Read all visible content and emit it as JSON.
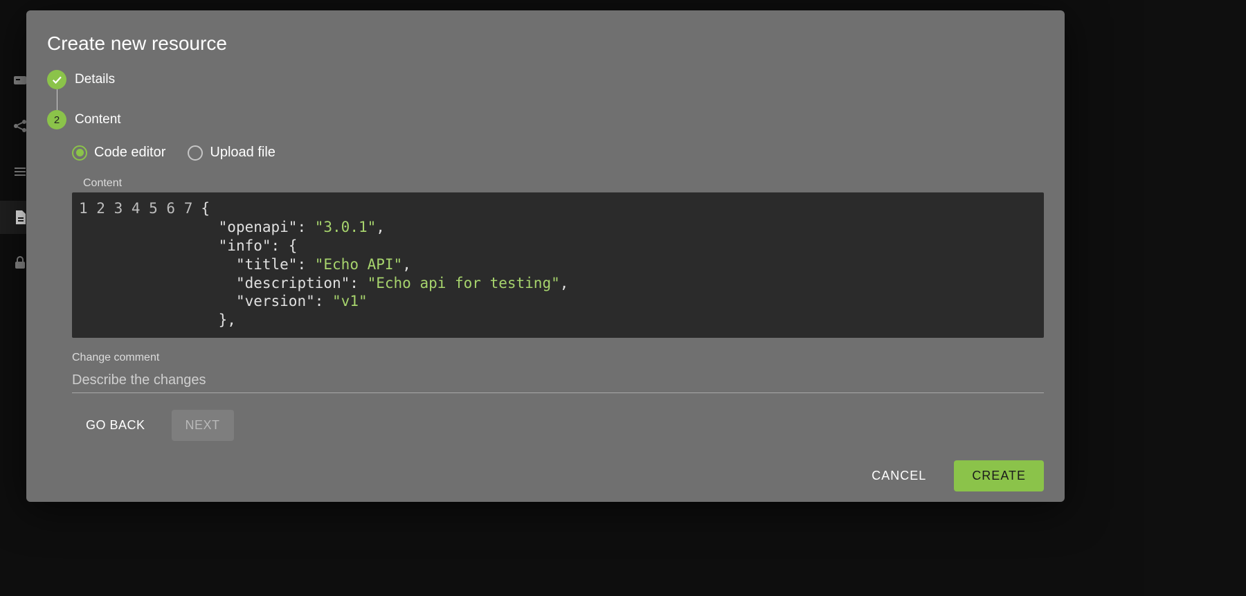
{
  "modal": {
    "title": "Create new resource",
    "steps": [
      {
        "id": "details",
        "label": "Details",
        "state": "done"
      },
      {
        "id": "content",
        "label": "Content",
        "state": "current",
        "number": "2"
      }
    ],
    "content": {
      "radios": [
        {
          "id": "code-editor",
          "label": "Code editor",
          "selected": true
        },
        {
          "id": "upload-file",
          "label": "Upload file",
          "selected": false
        }
      ],
      "editor_label": "Content",
      "code_lines": [
        {
          "n": "1",
          "tokens": [
            {
              "t": "pun",
              "v": "{"
            }
          ]
        },
        {
          "n": "2",
          "tokens": [
            {
              "t": "pun",
              "v": "  \"openapi\": "
            },
            {
              "t": "str",
              "v": "\"3.0.1\""
            },
            {
              "t": "pun",
              "v": ","
            }
          ]
        },
        {
          "n": "3",
          "tokens": [
            {
              "t": "pun",
              "v": "  \"info\": {"
            }
          ]
        },
        {
          "n": "4",
          "tokens": [
            {
              "t": "pun",
              "v": "    \"title\": "
            },
            {
              "t": "str",
              "v": "\"Echo API\""
            },
            {
              "t": "pun",
              "v": ","
            }
          ]
        },
        {
          "n": "5",
          "tokens": [
            {
              "t": "pun",
              "v": "    \"description\": "
            },
            {
              "t": "str",
              "v": "\"Echo api for testing\""
            },
            {
              "t": "pun",
              "v": ","
            }
          ]
        },
        {
          "n": "6",
          "tokens": [
            {
              "t": "pun",
              "v": "    \"version\": "
            },
            {
              "t": "str",
              "v": "\"v1\""
            }
          ]
        },
        {
          "n": "7",
          "tokens": [
            {
              "t": "pun",
              "v": "  },"
            }
          ]
        }
      ],
      "change_comment_label": "Change comment",
      "change_comment_placeholder": "Describe the changes",
      "change_comment_value": "",
      "nav": {
        "back": "GO BACK",
        "next": "NEXT"
      }
    },
    "footer": {
      "cancel": "CANCEL",
      "create": "CREATE"
    }
  },
  "sidebar_icons": [
    "card-icon",
    "share-icon",
    "list-icon",
    "doc-icon",
    "lock-icon"
  ],
  "colors": {
    "accent": "#8bc34a",
    "modal_bg": "#707070",
    "editor_bg": "#2b2b2b"
  }
}
